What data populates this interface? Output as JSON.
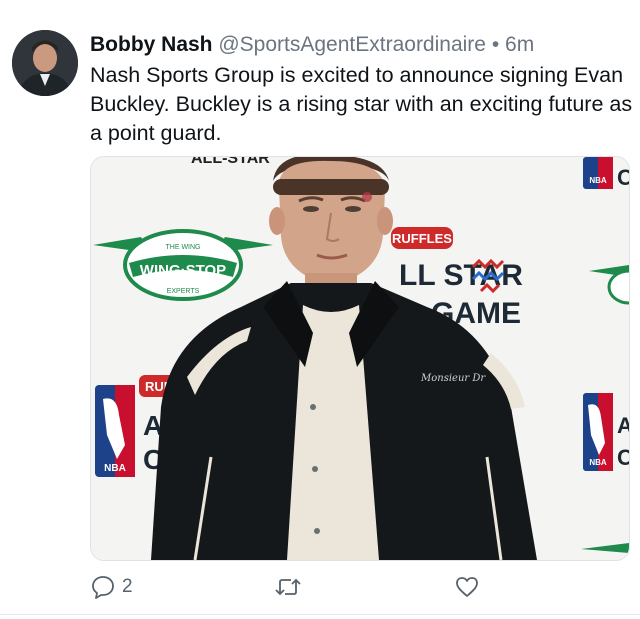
{
  "tweet": {
    "display_name": "Bobby Nash",
    "handle": "@SportsAgentExtraordinaire",
    "separator": "•",
    "time": "6m",
    "text": "Nash Sports Group is excited to announce signing Evan Buckley. Buckley is a rising star with an exciting future as a point guard."
  },
  "media": {
    "backdrop_wingstop": "WING·STOP",
    "backdrop_wingstop_top": "THE WING",
    "backdrop_wingstop_bottom": "EXPERTS",
    "backdrop_ruffles": "RUFFLES",
    "backdrop_allstar_line1": "LL STAR",
    "backdrop_allstar_line2": "GAME",
    "backdrop_ruffles_left": "RUF",
    "backdrop_al": "AL",
    "backdrop_c": "C",
    "backdrop_nba": "NBA",
    "backdrop_top_fragment": "ALL-STAR",
    "jacket_signature": "Monsieur Dr"
  },
  "actions": {
    "reply_count": "2",
    "retweet_count": "",
    "like_count": ""
  }
}
